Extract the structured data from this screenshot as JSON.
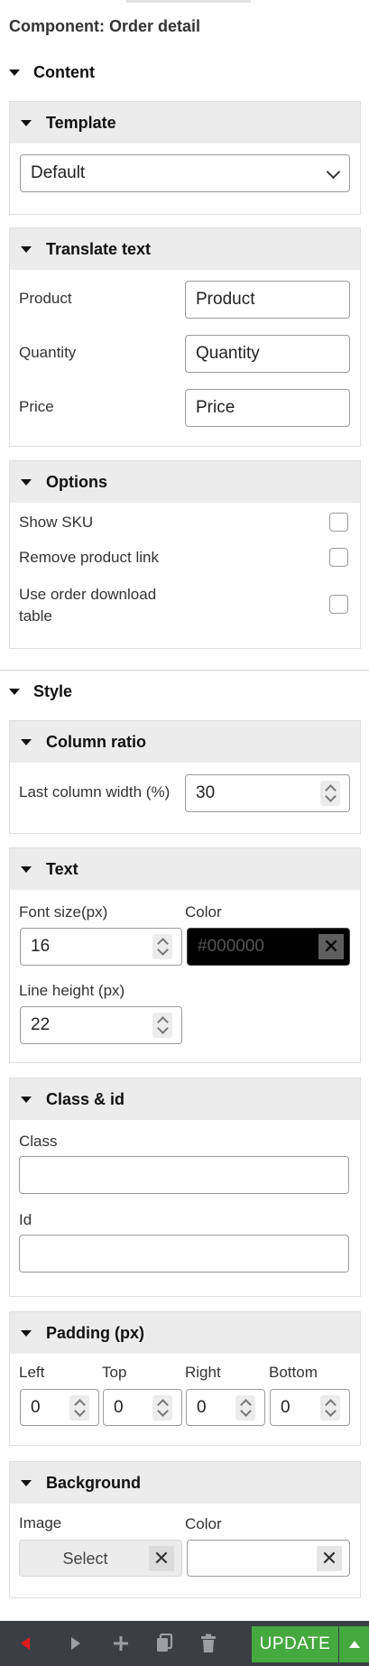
{
  "header": {
    "title": "Component: Order detail"
  },
  "sections": {
    "content": "Content",
    "style": "Style"
  },
  "template": {
    "title": "Template",
    "selected": "Default"
  },
  "translate": {
    "title": "Translate text",
    "rows": [
      {
        "label": "Product",
        "value": "Product"
      },
      {
        "label": "Quantity",
        "value": "Quantity"
      },
      {
        "label": "Price",
        "value": "Price"
      }
    ]
  },
  "options": {
    "title": "Options",
    "items": [
      {
        "label": "Show SKU",
        "checked": false
      },
      {
        "label": "Remove product link",
        "checked": false
      },
      {
        "label_line1": "Use order download",
        "label_line2": "table",
        "checked": false
      }
    ]
  },
  "column_ratio": {
    "title": "Column ratio",
    "label": "Last column width (%)",
    "value": "30"
  },
  "text": {
    "title": "Text",
    "font_size_label": "Font size(px)",
    "font_size": "16",
    "color_label": "Color",
    "color_placeholder": "#000000",
    "line_height_label": "Line height (px)",
    "line_height": "22"
  },
  "class_id": {
    "title": "Class & id",
    "class_label": "Class",
    "class_value": "",
    "id_label": "Id",
    "id_value": ""
  },
  "padding": {
    "title": "Padding (px)",
    "fields": [
      {
        "label": "Left",
        "value": "0"
      },
      {
        "label": "Top",
        "value": "0"
      },
      {
        "label": "Right",
        "value": "0"
      },
      {
        "label": "Bottom",
        "value": "0"
      }
    ]
  },
  "background": {
    "title": "Background",
    "image_label": "Image",
    "select_label": "Select",
    "color_label": "Color"
  },
  "toolbar": {
    "update_label": "UPDATE",
    "colors": {
      "bar": "#3b3f45",
      "update": "#45a93f",
      "back_arrow": "#e0191e"
    }
  }
}
